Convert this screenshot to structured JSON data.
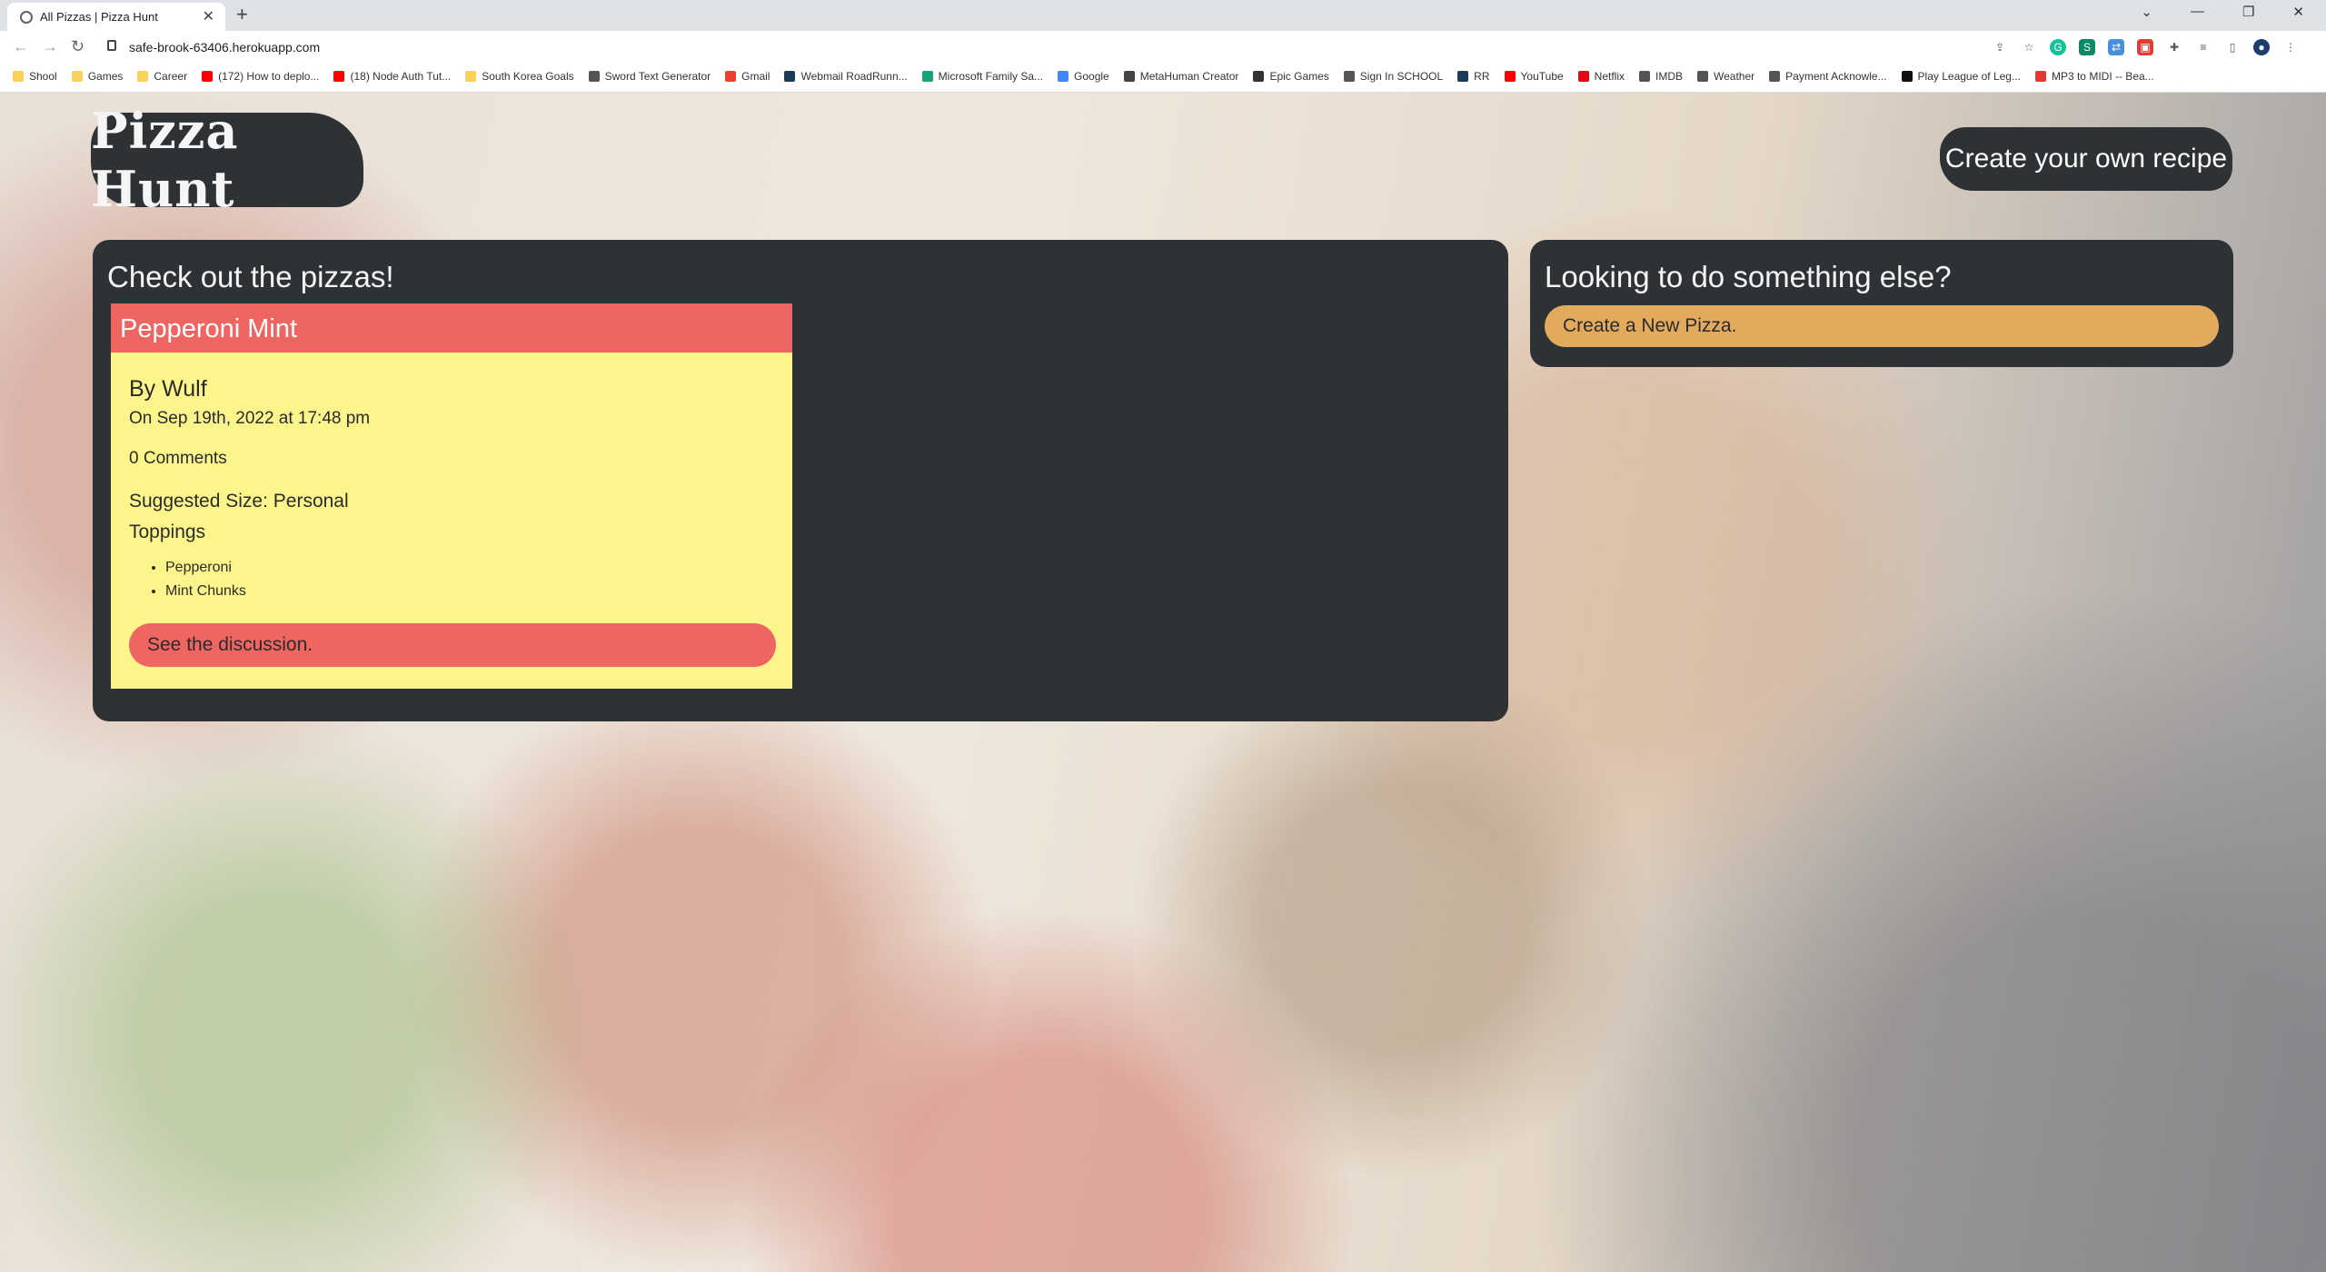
{
  "browser": {
    "tab_title": "All Pizzas | Pizza Hunt",
    "url": "safe-brook-63406.herokuapp.com",
    "bookmarks": [
      {
        "label": "Shool",
        "color": "#f7d25c"
      },
      {
        "label": "Games",
        "color": "#f7d25c"
      },
      {
        "label": "Career",
        "color": "#f7d25c"
      },
      {
        "label": "(172) How to deplo...",
        "color": "#ff0000"
      },
      {
        "label": "(18) Node Auth Tut...",
        "color": "#ff0000"
      },
      {
        "label": "South Korea Goals",
        "color": "#f7d25c"
      },
      {
        "label": "Sword Text Generator",
        "color": "#555555"
      },
      {
        "label": "Gmail",
        "color": "#ea4335"
      },
      {
        "label": "Webmail RoadRunn...",
        "color": "#1a3b5c"
      },
      {
        "label": "Microsoft Family Sa...",
        "color": "#1aa37a"
      },
      {
        "label": "Google",
        "color": "#4285f4"
      },
      {
        "label": "MetaHuman Creator",
        "color": "#444444"
      },
      {
        "label": "Epic Games",
        "color": "#333333"
      },
      {
        "label": "Sign In SCHOOL",
        "color": "#555555"
      },
      {
        "label": "RR",
        "color": "#1a3b5c"
      },
      {
        "label": "YouTube",
        "color": "#ff0000"
      },
      {
        "label": "Netflix",
        "color": "#e50914"
      },
      {
        "label": "IMDB",
        "color": "#555555"
      },
      {
        "label": "Weather",
        "color": "#555555"
      },
      {
        "label": "Payment Acknowle...",
        "color": "#555555"
      },
      {
        "label": "Play League of Leg...",
        "color": "#111111"
      },
      {
        "label": "MP3 to MIDI -- Bea...",
        "color": "#e53935"
      }
    ]
  },
  "header": {
    "logo": "Pizza Hunt",
    "create_recipe_label": "Create your own recipe"
  },
  "main": {
    "title": "Check out the pizzas!",
    "pizzas": [
      {
        "name": "Pepperoni Mint",
        "by": "By Wulf",
        "date": "On Sep 19th, 2022 at 17:48 pm",
        "comments": "0 Comments",
        "size": "Suggested Size: Personal",
        "toppings_heading": "Toppings",
        "toppings": [
          "Pepperoni",
          "Mint Chunks"
        ],
        "discussion_label": "See the discussion."
      }
    ]
  },
  "sidebar": {
    "title": "Looking to do something else?",
    "new_pizza_label": "Create a New Pizza."
  },
  "colors": {
    "panel": "#2f3235",
    "card_header": "#ee6561",
    "card_body": "#fcf58c",
    "new_pizza_button": "#e3a95c"
  }
}
